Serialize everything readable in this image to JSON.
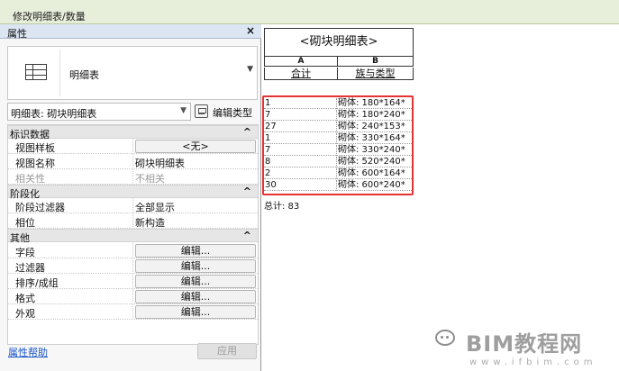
{
  "window": {
    "title": "修改明细表/数量"
  },
  "properties": {
    "header": "属性",
    "close_icon": "close-icon",
    "type_name": "明细表",
    "selector_text": "明细表: 砌块明细表",
    "edit_type_label": "编辑类型",
    "sections": [
      {
        "label": "标识数据",
        "rows": [
          {
            "key": "视图样板",
            "value": "<无>",
            "kind": "button"
          },
          {
            "key": "视图名称",
            "value": "砌块明细表",
            "kind": "text"
          },
          {
            "key": "相关性",
            "value": "不相关",
            "kind": "muted"
          }
        ]
      },
      {
        "label": "阶段化",
        "rows": [
          {
            "key": "阶段过滤器",
            "value": "全部显示",
            "kind": "text"
          },
          {
            "key": "相位",
            "value": "新构造",
            "kind": "text"
          }
        ]
      },
      {
        "label": "其他",
        "rows": [
          {
            "key": "字段",
            "value": "编辑...",
            "kind": "button"
          },
          {
            "key": "过滤器",
            "value": "编辑...",
            "kind": "button"
          },
          {
            "key": "排序/成组",
            "value": "编辑...",
            "kind": "button"
          },
          {
            "key": "格式",
            "value": "编辑...",
            "kind": "button"
          },
          {
            "key": "外观",
            "value": "编辑...",
            "kind": "button"
          }
        ]
      }
    ],
    "chevron": "^",
    "help_link": "属性帮助",
    "apply_label": "应用"
  },
  "schedule": {
    "title": "<砌块明细表>",
    "columns": [
      {
        "letter": "A",
        "name": "合计"
      },
      {
        "letter": "B",
        "name": "族与类型"
      }
    ],
    "rows": [
      {
        "count": "1",
        "type": "砌体: 180*164*"
      },
      {
        "count": "7",
        "type": "砌体: 180*240*"
      },
      {
        "count": "27",
        "type": "砌体: 240*153*"
      },
      {
        "count": "1",
        "type": "砌体: 330*164*"
      },
      {
        "count": "7",
        "type": "砌体: 330*240*"
      },
      {
        "count": "8",
        "type": "砌体: 520*240*"
      },
      {
        "count": "2",
        "type": "砌体: 600*164*"
      },
      {
        "count": "30",
        "type": "砌体: 600*240*"
      }
    ],
    "total": "总计: 83",
    "highlight_color": "#e53232"
  },
  "watermark": {
    "icon": "wechat-icon",
    "main": "BIM教程网",
    "sub": "www.ifbim.com"
  }
}
